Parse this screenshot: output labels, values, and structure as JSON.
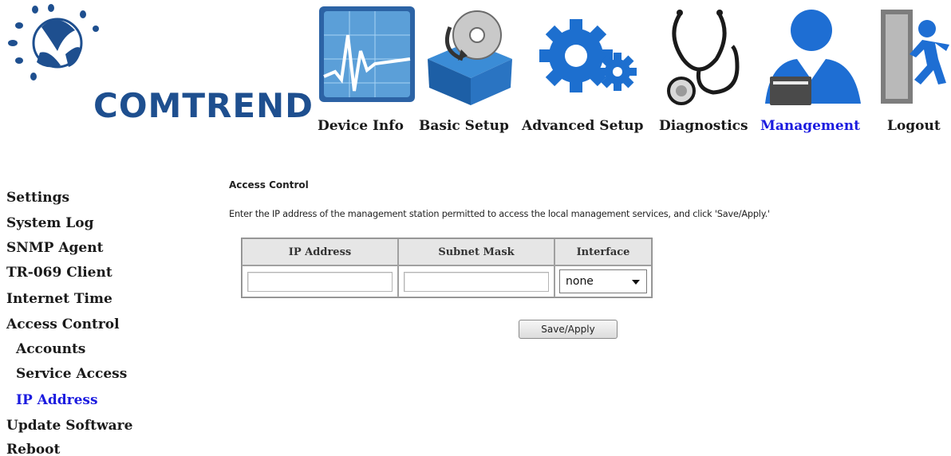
{
  "brand": {
    "name": "COMTREND",
    "brand_color": "#1e4f8f"
  },
  "nav": {
    "items": [
      {
        "label": "Device Info",
        "icon": "monitor-chart-icon"
      },
      {
        "label": "Basic Setup",
        "icon": "box-disc-icon"
      },
      {
        "label": "Advanced Setup",
        "icon": "gears-icon"
      },
      {
        "label": "Diagnostics",
        "icon": "stethoscope-icon"
      },
      {
        "label": "Management",
        "icon": "user-card-icon"
      },
      {
        "label": "Logout",
        "icon": "exit-runner-icon"
      }
    ],
    "active": "Management",
    "active_color": "#1b1bdf"
  },
  "sidebar": {
    "items": [
      {
        "label": "Settings"
      },
      {
        "label": "System Log"
      },
      {
        "label": "SNMP Agent"
      },
      {
        "label": "TR-069 Client"
      },
      {
        "label": "Internet Time"
      },
      {
        "label": "Access Control"
      },
      {
        "label": "Accounts"
      },
      {
        "label": "Service Access"
      },
      {
        "label": "IP Address"
      },
      {
        "label": "Update Software"
      },
      {
        "label": "Reboot"
      }
    ],
    "active": "IP Address"
  },
  "main": {
    "title": "Access Control",
    "instruction": "Enter the IP address of the management station permitted to access the local management services, and click 'Save/Apply.'",
    "table": {
      "headers": [
        "IP Address",
        "Subnet Mask",
        "Interface"
      ],
      "ip_value": "",
      "mask_value": "",
      "interface_value": "none"
    },
    "save_label": "Save/Apply"
  }
}
